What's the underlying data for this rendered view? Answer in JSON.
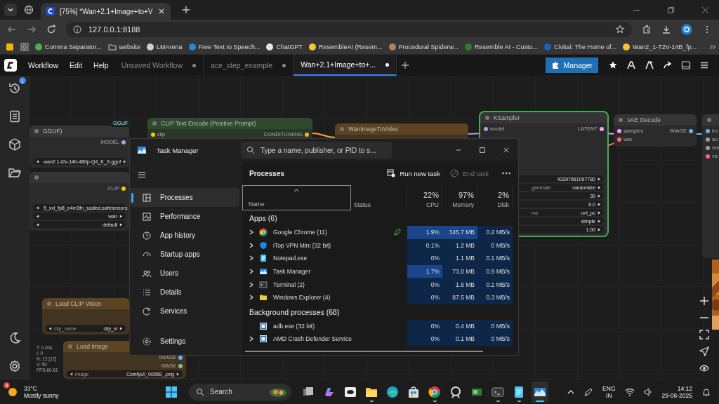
{
  "browser": {
    "tabs": [
      {
        "title": "[75%] *Wan+2.1+Image+to+V",
        "selected": true
      }
    ],
    "url": "127.0.0.1:8188",
    "bookmarks": [
      {
        "label": "Comma Separator...",
        "kind": "site",
        "color": "#4caf50"
      },
      {
        "label": "website",
        "kind": "folder"
      },
      {
        "label": "LMArena",
        "kind": "site",
        "color": "#cfcfcf"
      },
      {
        "label": "Free Text to Speech...",
        "kind": "site",
        "color": "#1e88e5"
      },
      {
        "label": "ChatGPT",
        "kind": "site",
        "color": "#e6e6e6"
      },
      {
        "label": "ResembleAI (Resem...",
        "kind": "site",
        "color": "#f4c430"
      },
      {
        "label": "Procedural Spiderw...",
        "kind": "site",
        "color": "#b08060"
      },
      {
        "label": "Resemble AI - Custo...",
        "kind": "site",
        "color": "#2e7d32"
      },
      {
        "label": "Civitai: The Home of...",
        "kind": "site",
        "color": "#1565c0"
      },
      {
        "label": "Wan2_1-T2V-14B_fp...",
        "kind": "site",
        "color": "#f4c430"
      }
    ]
  },
  "comfy": {
    "menu": [
      "Workflow",
      "Edit",
      "Help"
    ],
    "tabs": [
      {
        "title": "Unsaved Workflow",
        "selected": false,
        "unsaved": true
      },
      {
        "title": "ace_step_example",
        "selected": false,
        "unsaved": true
      },
      {
        "title": "Wan+2.1+Image+to+...",
        "selected": true,
        "unsaved": true
      }
    ],
    "manager": "Manager",
    "queue_badge": "1",
    "badge": "GGUF",
    "stats": [
      "T: 0.00s",
      "I: 0",
      "N: 12 [12]",
      "V: 50",
      "FPS:60.61"
    ],
    "nodes": [
      {
        "title": "GGUF)",
        "color": "#353535",
        "selected": false,
        "outputs": [
          {
            "name": "MODEL",
            "color": "#b39ddb"
          }
        ],
        "widgets": [
          {
            "value": "wan2.1-i2v-14b-480p-Q4_K_S.gguf"
          }
        ]
      },
      {
        "color": "#353535",
        "selected": false,
        "outputs": [
          {
            "name": "CLIP",
            "color": "#f5c518"
          }
        ],
        "widgets": [
          {
            "value": "5_xxl_fp8_e4m3fn_scaled.safetensors"
          },
          {
            "value": "wan"
          },
          {
            "value": "default"
          }
        ]
      },
      {
        "title": "CLIP Text Encode (Positive Prompt)",
        "color": "#2f4a2f",
        "selected": false,
        "inputs": [
          {
            "name": "clip",
            "color": "#f5c518"
          }
        ],
        "outputs": [
          {
            "name": "CONDITIONING",
            "color": "#ffa931"
          }
        ]
      },
      {
        "title": "WanImageToVideo",
        "color": "#5c4422",
        "selected": false
      },
      {
        "title": "KSampler",
        "color": "#353535",
        "selected": true,
        "inputs": [
          {
            "name": "model",
            "color": "#b39ddb"
          }
        ],
        "outputs": [
          {
            "name": "LATENT",
            "color": "#ff9cf9"
          }
        ],
        "widgets": [
          {
            "value": "43397661097780"
          },
          {
            "label": "generate",
            "value": "randomize"
          },
          {
            "value": "30"
          },
          {
            "value": "6.0"
          },
          {
            "label": "me",
            "value": "uni_pc"
          },
          {
            "value": "simple"
          },
          {
            "value": "1.00"
          }
        ]
      },
      {
        "title": "VAE Decode",
        "color": "#353535",
        "selected": false,
        "inputs": [
          {
            "name": "samples",
            "color": "#ff9cf9"
          },
          {
            "name": "vae",
            "color": "#ff6e6e"
          }
        ],
        "outputs": [
          {
            "name": "IMAGE",
            "color": "#64b5f6"
          }
        ]
      },
      {
        "color": "#353535",
        "selected": false,
        "inputs": [
          {
            "name": "im",
            "color": "#64b5f6"
          },
          {
            "name": "au",
            "color": "#9e9e9e"
          },
          {
            "name": "me",
            "color": "#9e9e9e"
          },
          {
            "name": "va",
            "color": "#ff6e6e"
          }
        ]
      },
      {
        "title": "Load CLIP Vision",
        "color": "#5c4422",
        "selected": false,
        "widgets": [
          {
            "label": "clip_name",
            "value": "clip_vi"
          }
        ]
      },
      {
        "title": "Load Image",
        "color": "#5c4422",
        "selected": false,
        "outputs": [
          {
            "name": "IMAGE",
            "color": "#64b5f6"
          },
          {
            "name": "MASK",
            "color": "#81c784"
          }
        ],
        "widgets": [
          {
            "label": "image",
            "value": "ComfyUI_00069_.png"
          }
        ]
      }
    ]
  },
  "task_manager": {
    "title": "Task Manager",
    "search_placeholder": "Type a name, publisher, or PID to s...",
    "nav": [
      {
        "label": "Processes",
        "kind": "processes",
        "selected": true
      },
      {
        "label": "Performance",
        "kind": "performance",
        "selected": false
      },
      {
        "label": "App history",
        "kind": "history",
        "selected": false
      },
      {
        "label": "Startup apps",
        "kind": "startup",
        "selected": false
      },
      {
        "label": "Users",
        "kind": "users",
        "selected": false
      },
      {
        "label": "Details",
        "kind": "details",
        "selected": false
      },
      {
        "label": "Services",
        "kind": "services",
        "selected": false
      }
    ],
    "settings": "Settings",
    "page_title": "Processes",
    "actions": [
      {
        "label": "Run new task",
        "kind": "run",
        "disabled": false
      },
      {
        "label": "End task",
        "kind": "end",
        "disabled": true
      }
    ],
    "columns": {
      "name": "Name",
      "status": "Status",
      "cpu": {
        "label": "CPU",
        "total": "22%"
      },
      "memory": {
        "label": "Memory",
        "total": "97%"
      },
      "disk": {
        "label": "Disk",
        "total": "2%"
      }
    },
    "groups": [
      {
        "title": "Apps (6)",
        "rows": [
          {
            "name": "Google Chrome (11)",
            "kind": "chrome",
            "expandable": true,
            "eco": true,
            "cpu": "1.9%",
            "memory": "345.7 MB",
            "disk": "0.2 MB/s",
            "cpu_hot": true,
            "memory_hot": true
          },
          {
            "name": "iTop VPN Mini (32 bit)",
            "kind": "vpn",
            "expandable": true,
            "eco": false,
            "cpu": "0.1%",
            "memory": "1.2 MB",
            "disk": "0 MB/s",
            "cpu_hot": false,
            "memory_hot": false
          },
          {
            "name": "Notepad.exe",
            "kind": "notepad",
            "expandable": true,
            "eco": false,
            "cpu": "0%",
            "memory": "1.1 MB",
            "disk": "0.1 MB/s",
            "cpu_hot": false,
            "memory_hot": false
          },
          {
            "name": "Task Manager",
            "kind": "taskmgr",
            "expandable": true,
            "eco": false,
            "cpu": "1.7%",
            "memory": "73.0 MB",
            "disk": "0.9 MB/s",
            "cpu_hot": true,
            "memory_hot": false
          },
          {
            "name": "Terminal (2)",
            "kind": "terminal",
            "expandable": true,
            "eco": false,
            "cpu": "0%",
            "memory": "1.6 MB",
            "disk": "0.1 MB/s",
            "cpu_hot": false,
            "memory_hot": false
          },
          {
            "name": "Windows Explorer (4)",
            "kind": "folder",
            "expandable": true,
            "eco": false,
            "cpu": "0%",
            "memory": "87.5 MB",
            "disk": "0.3 MB/s",
            "cpu_hot": false,
            "memory_hot": false
          }
        ]
      },
      {
        "title": "Background processes (68)",
        "rows": [
          {
            "name": "adb.exe (32 bit)",
            "kind": "app",
            "expandable": false,
            "eco": false,
            "cpu": "0%",
            "memory": "0.4 MB",
            "disk": "0 MB/s",
            "cpu_hot": false,
            "memory_hot": false
          },
          {
            "name": "AMD Crash Defender Service",
            "kind": "app",
            "expandable": true,
            "eco": false,
            "cpu": "0%",
            "memory": "0.1 MB",
            "disk": "0 MB/s",
            "cpu_hot": false,
            "memory_hot": false
          }
        ]
      }
    ]
  },
  "taskbar": {
    "weather": {
      "badge": "8",
      "temp": "33°C",
      "desc": "Mostly sunny"
    },
    "search": "Search",
    "apps": [
      {
        "kind": "taskview",
        "running": false,
        "selected": false
      },
      {
        "kind": "copilot",
        "running": false,
        "selected": false
      },
      {
        "kind": "eyeapp",
        "running": false,
        "selected": false
      },
      {
        "kind": "explorer",
        "running": true,
        "selected": false
      },
      {
        "kind": "edge",
        "running": false,
        "selected": false
      },
      {
        "kind": "store",
        "running": false,
        "selected": false
      },
      {
        "kind": "chrome",
        "running": true,
        "selected": false
      },
      {
        "kind": "ring",
        "running": false,
        "selected": false
      },
      {
        "kind": "card",
        "running": false,
        "selected": false
      },
      {
        "kind": "terminal",
        "running": true,
        "selected": false
      },
      {
        "kind": "notepad",
        "running": true,
        "selected": false
      },
      {
        "kind": "taskmgr",
        "running": true,
        "selected": true
      }
    ],
    "lang": "ENG",
    "region": "IN",
    "time": "14:12",
    "date": "29-06-2025"
  }
}
